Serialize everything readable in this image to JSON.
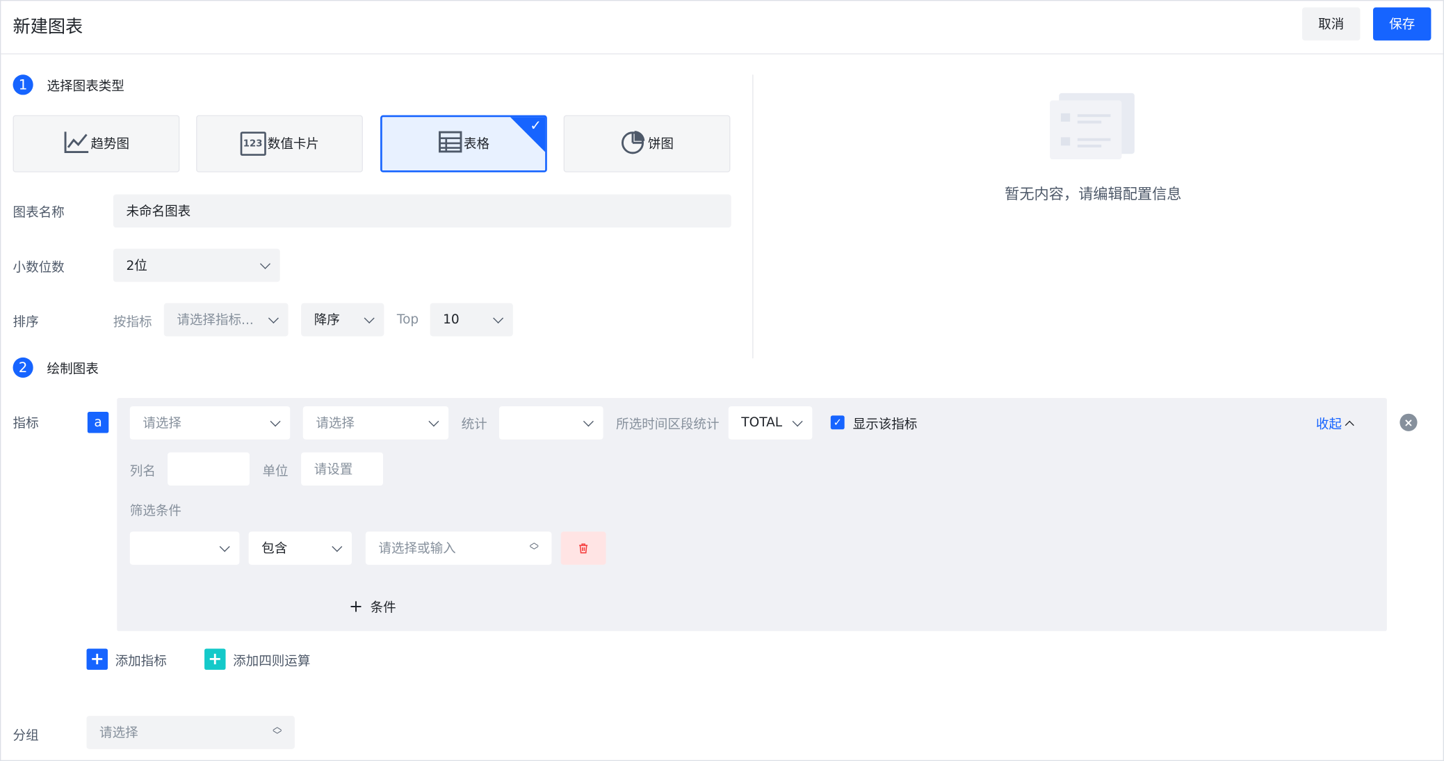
{
  "header": {
    "title": "新建图表",
    "cancel_label": "取消",
    "save_label": "保存"
  },
  "step1": {
    "number": "1",
    "label": "选择图表类型"
  },
  "chart_types": [
    {
      "label": "趋势图",
      "icon": "line-chart-icon"
    },
    {
      "label": "数值卡片",
      "icon": "number-card-icon",
      "icon_text": "123"
    },
    {
      "label": "表格",
      "icon": "table-icon",
      "selected": true
    },
    {
      "label": "饼图",
      "icon": "pie-chart-icon"
    }
  ],
  "form": {
    "name_label": "图表名称",
    "name_value": "未命名图表",
    "decimal_label": "小数位数",
    "decimal_value": "2位",
    "sort_label": "排序",
    "sort_by_label": "按指标",
    "sort_metric_placeholder": "请选择指标...",
    "sort_order_value": "降序",
    "top_label": "Top",
    "top_value": "10"
  },
  "step2": {
    "number": "2",
    "label": "绘制图表"
  },
  "metric": {
    "label": "指标",
    "badge": "a",
    "select1_placeholder": "请选择",
    "select2_placeholder": "请选择",
    "stat_label": "统计",
    "stat_value": "",
    "period_label": "所选时间区段统计",
    "period_value": "TOTAL",
    "show_label": "显示该指标",
    "show_checked": true,
    "collapse_label": "收起",
    "colname_label": "列名",
    "colname_value": "",
    "unit_label": "单位",
    "unit_placeholder": "请设置",
    "filter_label": "筛选条件",
    "filter_field_value": "",
    "filter_op_value": "包含",
    "filter_value_placeholder": "请选择或输入",
    "add_condition_label": "条件"
  },
  "actions": {
    "add_metric_label": "添加指标",
    "add_calc_label": "添加四则运算"
  },
  "group": {
    "label": "分组",
    "placeholder": "请选择"
  },
  "preview": {
    "empty_text": "暂无内容，请编辑配置信息"
  },
  "colors": {
    "primary": "#1664ff",
    "teal": "#14c9c9",
    "danger": "#f53f3f"
  }
}
